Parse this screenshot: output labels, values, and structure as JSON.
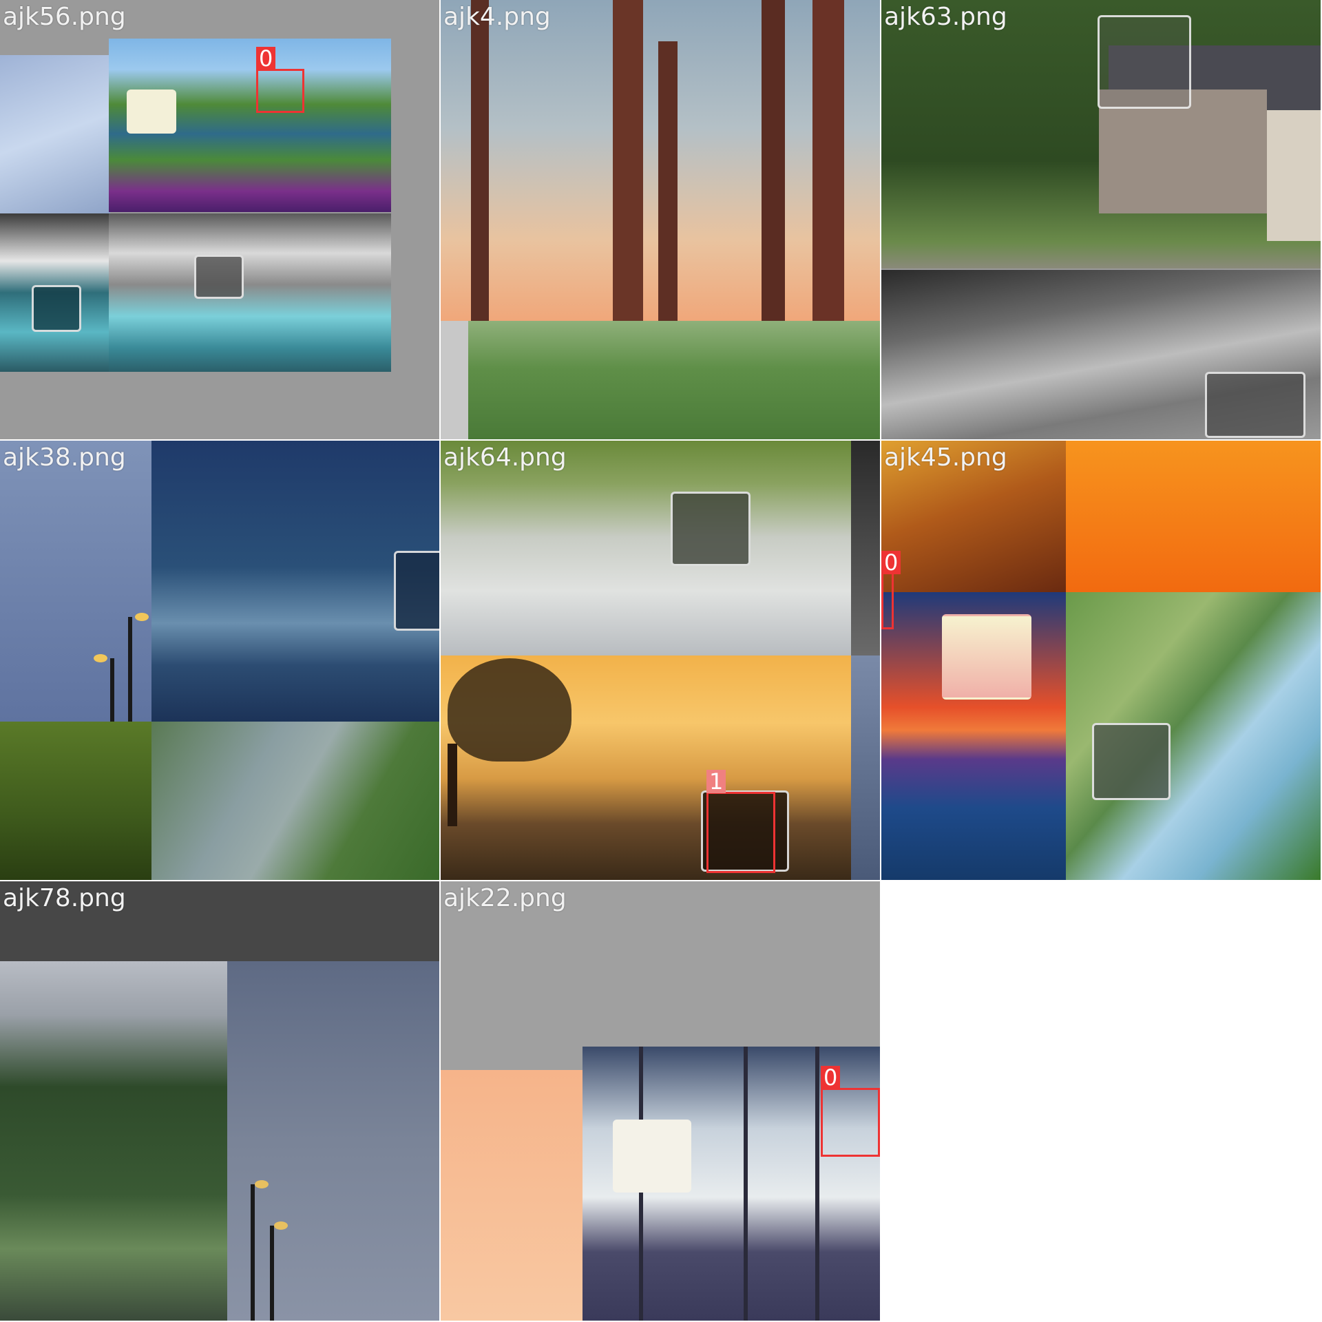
{
  "tiles": [
    {
      "filename": "ajk56.png",
      "labels": [
        "0"
      ]
    },
    {
      "filename": "ajk4.png",
      "labels": []
    },
    {
      "filename": "ajk63.png",
      "labels": []
    },
    {
      "filename": "ajk38.png",
      "labels": []
    },
    {
      "filename": "ajk64.png",
      "labels": [
        "1"
      ]
    },
    {
      "filename": "ajk45.png",
      "labels": [
        "0"
      ]
    },
    {
      "filename": "ajk78.png",
      "labels": []
    },
    {
      "filename": "ajk22.png",
      "labels": [
        "0"
      ]
    }
  ],
  "colors": {
    "box": "#ee3333",
    "box_light": "#f08080",
    "tile_bg": "#9a9a9a",
    "text": "#f2f2f2"
  }
}
